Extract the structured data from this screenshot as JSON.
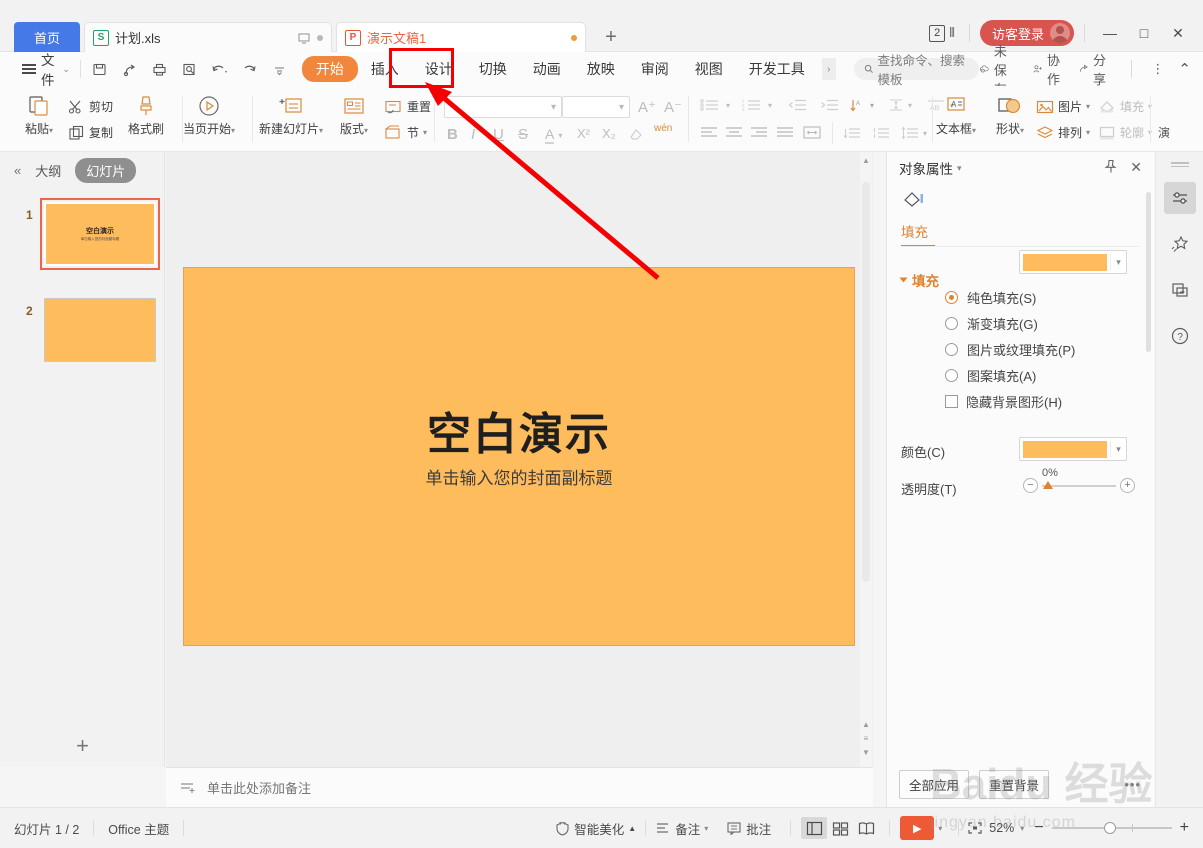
{
  "titlebar": {
    "home_tab": "首页",
    "tabs": [
      {
        "name": "计划.xls",
        "type": "sheet-icon",
        "letter": "S"
      },
      {
        "name": "演示文稿1",
        "type": "ppt-icon",
        "letter": "P"
      }
    ],
    "new_tab": "+",
    "count_badge": "2",
    "guest_label": "访客登录",
    "minimize": "—",
    "maximize": "□",
    "close": "✕"
  },
  "ribbon_tabs": {
    "file_label": "文件",
    "quick_access": [
      "save-icon",
      "save-as-icon",
      "print-icon",
      "print-preview-icon",
      "undo-icon",
      "redo-icon",
      "customize-icon"
    ],
    "tabs": [
      {
        "label": "开始",
        "active": true
      },
      {
        "label": "插入",
        "active": false
      },
      {
        "label": "设计",
        "active": false,
        "highlighted": true
      },
      {
        "label": "切换",
        "active": false
      },
      {
        "label": "动画",
        "active": false
      },
      {
        "label": "放映",
        "active": false
      },
      {
        "label": "审阅",
        "active": false
      },
      {
        "label": "视图",
        "active": false
      },
      {
        "label": "开发工具",
        "active": false
      }
    ],
    "more_tabs": "›",
    "search_placeholder": "查找命令、搜索模板",
    "actions": [
      {
        "label": "未保存",
        "icon": "cloud-icon"
      },
      {
        "label": "协作",
        "icon": "collaborate-icon"
      },
      {
        "label": "分享",
        "icon": "share-icon"
      }
    ],
    "overflow": "⋮",
    "collapse": "⌃"
  },
  "ribbon": {
    "clipboard": {
      "paste": "粘贴",
      "cut": "剪切",
      "copy": "复制",
      "format_painter": "格式刷"
    },
    "present": {
      "from_current": "当页开始"
    },
    "slides": {
      "new_slide": "新建幻灯片",
      "layout": "版式",
      "reset": "重置",
      "section": "节"
    },
    "font": {
      "font_name": "",
      "font_size": "",
      "grow": "A⁺",
      "shrink": "A⁻",
      "bold": "B",
      "italic": "I",
      "underline": "U",
      "strike": "S",
      "font_color": "A",
      "superscript": "X²",
      "subscript": "X₂",
      "clear_format": "clear-format-icon",
      "pinyin": "wén"
    },
    "drawing": {
      "text_box": "文本框",
      "shapes": "形状",
      "picture": "图片",
      "arrange": "排列",
      "fill": "填充",
      "outline": "轮廓",
      "overflow": "演"
    }
  },
  "left_panel": {
    "collapse": "«",
    "tab_outline": "大纲",
    "tab_slides": "幻灯片",
    "slides": [
      {
        "number": "1",
        "title": "空白演示",
        "subtitle": "单击输入您的封面副标题",
        "selected": true
      },
      {
        "number": "2",
        "title": "",
        "subtitle": "",
        "selected": false
      }
    ],
    "add_slide": "+"
  },
  "slide": {
    "title": "空白演示",
    "subtitle": "单击输入您的封面副标题",
    "fill_color": "#ffbc5c"
  },
  "notes": {
    "placeholder": "单击此处添加备注"
  },
  "right_panel": {
    "title": "对象属性",
    "title_caret": "▾",
    "pin": "pin-icon",
    "close": "✕",
    "tab_label": "填充",
    "section_title": "填充",
    "fill_swatch": "#ffbc5c",
    "options": [
      {
        "label": "纯色填充(S)",
        "selected": true
      },
      {
        "label": "渐变填充(G)",
        "selected": false
      },
      {
        "label": "图片或纹理填充(P)",
        "selected": false
      },
      {
        "label": "图案填充(A)",
        "selected": false
      }
    ],
    "hide_bg_graphics": "隐藏背景图形(H)",
    "color_label": "颜色(C)",
    "color_swatch": "#ffbc5c",
    "transparency_label": "透明度(T)",
    "transparency_value": "0%",
    "apply_all": "全部应用",
    "reset_bg": "重置背景",
    "more": "•••"
  },
  "rail": {
    "icons": [
      {
        "name": "properties-sliders-icon",
        "active": true
      },
      {
        "name": "magic-star-icon",
        "active": false
      },
      {
        "name": "duplicate-window-icon",
        "active": false
      },
      {
        "name": "help-question-icon",
        "active": false
      }
    ]
  },
  "statusbar": {
    "slide_count": "幻灯片 1 / 2",
    "theme": "Office 主题",
    "beautify": "智能美化",
    "beautify_caret": "▲",
    "notes": "备注",
    "comments": "批注",
    "views": [
      {
        "name": "normal-view-icon",
        "active": true
      },
      {
        "name": "slide-sorter-icon",
        "active": false
      },
      {
        "name": "reading-view-icon",
        "active": false
      }
    ],
    "play": "▶",
    "fit_icon": "fit-to-window-icon",
    "zoom_level": "52%",
    "zoom_out": "−",
    "zoom_in": "+"
  },
  "watermark": {
    "main": "Baidu 经验",
    "sub": "jingyan.baidu.com"
  }
}
